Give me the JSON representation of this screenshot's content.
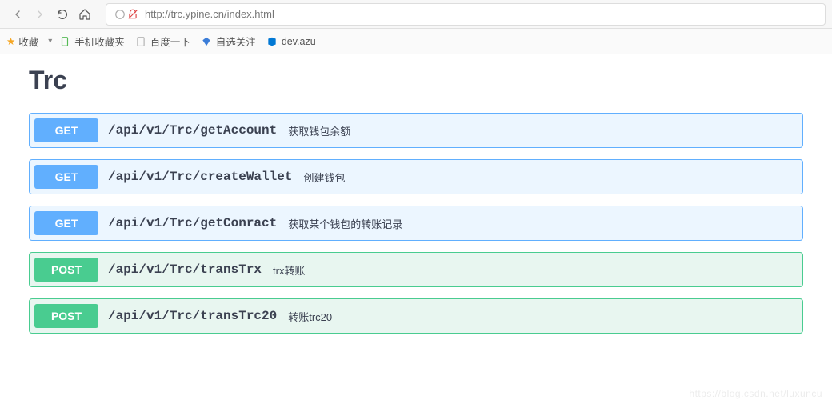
{
  "browser": {
    "url": "http://trc.ypine.cn/index.html"
  },
  "bookmarks": {
    "favorites_label": "收藏",
    "items": [
      {
        "label": "手机收藏夹",
        "icon": "mobile"
      },
      {
        "label": "百度一下",
        "icon": "page"
      },
      {
        "label": "自选关注",
        "icon": "diamond"
      },
      {
        "label": "dev.azu",
        "icon": "azure"
      }
    ]
  },
  "page": {
    "title": "Trc"
  },
  "endpoints": [
    {
      "method": "GET",
      "path": "/api/v1/Trc/getAccount",
      "desc": "获取钱包余额"
    },
    {
      "method": "GET",
      "path": "/api/v1/Trc/createWallet",
      "desc": "创建钱包"
    },
    {
      "method": "GET",
      "path": "/api/v1/Trc/getConract",
      "desc": "获取某个钱包的转账记录"
    },
    {
      "method": "POST",
      "path": "/api/v1/Trc/transTrx",
      "desc": "trx转账"
    },
    {
      "method": "POST",
      "path": "/api/v1/Trc/transTrc20",
      "desc": "转账trc20"
    }
  ],
  "watermark": "https://blog.csdn.net/luxuncu"
}
